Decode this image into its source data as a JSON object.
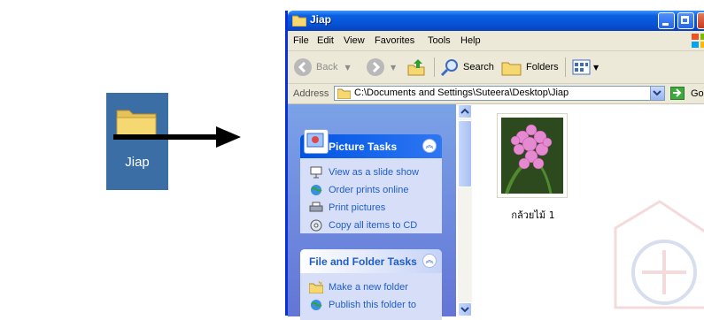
{
  "desktop_icon": {
    "label": "Jiap"
  },
  "window": {
    "title": "Jiap",
    "menu": [
      "File",
      "Edit",
      "View",
      "Favorites",
      "Tools",
      "Help"
    ],
    "toolbar": {
      "back": "Back",
      "search": "Search",
      "folders": "Folders"
    },
    "address": {
      "label": "Address",
      "path": "C:\\Documents and Settings\\Suteera\\Desktop\\Jiap",
      "go": "Go"
    },
    "picture_tasks": {
      "title": "Picture Tasks",
      "items": [
        "View as a slide show",
        "Order prints online",
        "Print pictures",
        "Copy all items to CD"
      ]
    },
    "file_folder_tasks": {
      "title": "File and Folder Tasks",
      "items": [
        "Make a new folder",
        "Publish this folder to"
      ]
    },
    "files": [
      {
        "name": "กล้วยไม้ 1"
      }
    ]
  },
  "colors": {
    "title_bar": "#0a5fe0",
    "task_pane": "#7ba2e7",
    "link": "#215dc6",
    "desktop": "#3a6ea5"
  }
}
